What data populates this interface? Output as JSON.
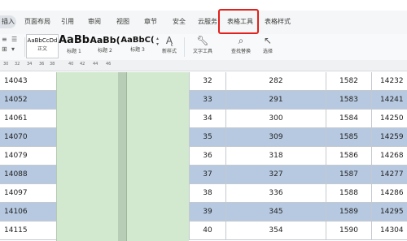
{
  "tabs": {
    "first": "插入",
    "items": [
      "页面布局",
      "引用",
      "审阅",
      "视图",
      "章节",
      "安全",
      "云服务",
      "表格工具",
      "表格样式"
    ]
  },
  "ribbon": {
    "styles": [
      {
        "sample": "AaBbCcDd",
        "label": "正文"
      },
      {
        "sample": "AaBb",
        "label": "标题 1"
      },
      {
        "sample": "AaBb(",
        "label": "标题 2"
      },
      {
        "sample": "AaBbC(",
        "label": "标题 3"
      }
    ],
    "new_style": "新样式",
    "text_tool": "文字工具",
    "find_replace": "查找替换",
    "select": "选择",
    "icons": {
      "font_style": "font-style-icon",
      "text_tool": "wrench-icon",
      "find": "search-icon",
      "select": "cursor-icon"
    }
  },
  "ruler": {
    "ticks": [
      "30",
      "32",
      "34",
      "36",
      "38",
      "40",
      "42",
      "44",
      "46"
    ]
  },
  "colors": {
    "accent_highlight": "#e3201b",
    "row_blue": "#b7c9e0",
    "column_green": "#d2e8cf"
  },
  "table": {
    "left_col": [
      "14043",
      "14052",
      "14061",
      "14070",
      "14079",
      "14088",
      "14097",
      "14106",
      "14115"
    ],
    "rows": [
      {
        "a": "32",
        "b": "282",
        "c": "1582",
        "d": "14232"
      },
      {
        "a": "33",
        "b": "291",
        "c": "1583",
        "d": "14241"
      },
      {
        "a": "34",
        "b": "300",
        "c": "1584",
        "d": "14250"
      },
      {
        "a": "35",
        "b": "309",
        "c": "1585",
        "d": "14259"
      },
      {
        "a": "36",
        "b": "318",
        "c": "1586",
        "d": "14268"
      },
      {
        "a": "37",
        "b": "327",
        "c": "1587",
        "d": "14277"
      },
      {
        "a": "38",
        "b": "336",
        "c": "1588",
        "d": "14286"
      },
      {
        "a": "39",
        "b": "345",
        "c": "1589",
        "d": "14295"
      },
      {
        "a": "40",
        "b": "354",
        "c": "1590",
        "d": "14304"
      }
    ]
  }
}
